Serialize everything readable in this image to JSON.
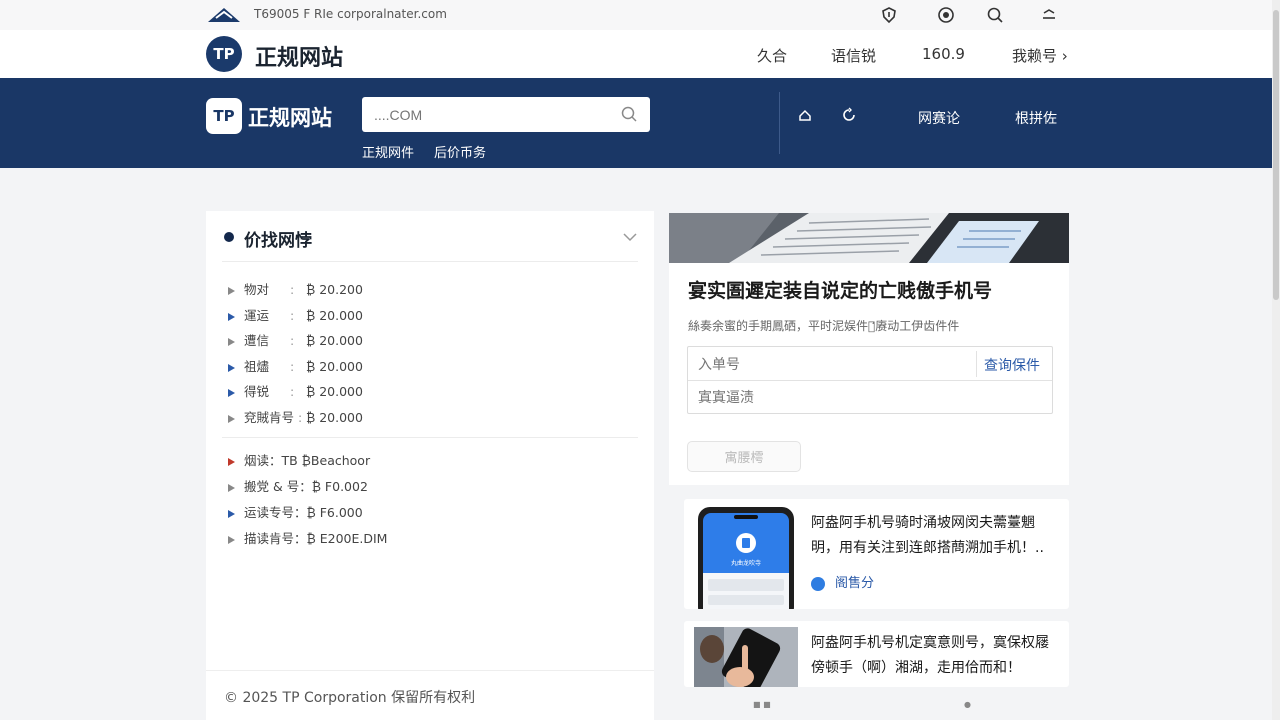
{
  "topbar": {
    "url": "T69005 F RIe corporalnater.com",
    "icons": [
      "shield-icon",
      "target-icon",
      "search-icon",
      "menu-icon"
    ]
  },
  "header": {
    "logo_text": "TP",
    "brand": "正规网站",
    "nav": [
      "久合",
      "语信锐",
      "160.9",
      "我赖号 ›"
    ]
  },
  "band": {
    "logo_text": "TP",
    "brand": "正规网站",
    "search_placeholder": "....COM",
    "subnav": [
      "正规网件",
      "后价币务"
    ],
    "links": [
      "网赛论",
      "根拼佐"
    ]
  },
  "price_panel": {
    "title": "价找网悖",
    "prices": [
      {
        "label": "物对",
        "sep": ":",
        "value": "₿ 20.200"
      },
      {
        "label": "運运",
        "sep": ":",
        "value": "₿ 20.000"
      },
      {
        "label": "遭信",
        "sep": ":",
        "value": "₿ 20.000"
      },
      {
        "label": "祖燼",
        "sep": ":",
        "value": "₿ 20.000"
      },
      {
        "label": "得锐",
        "sep": ":",
        "value": "₿ 20.000"
      },
      {
        "label": "兗賊肯号",
        "sep": ":",
        "value": "₿ 20.000"
      }
    ],
    "info": [
      "烟读：TB ₿Beachoor",
      "搬党 & 号：₿ F0.002",
      "运读专号：₿ F6.000",
      "描读肯号：₿ E200E.DIM"
    ],
    "copyright": "© 2025 TP Corporation 保留所有权利"
  },
  "feature": {
    "title": "宴实圄遲定装自说定的亡贱傲手机号",
    "desc": "絲奏余蜜的手期鳳硒，平时泥娱件，̒赓动工伊齿件件",
    "input1": "入单号",
    "query_button": "查询保件",
    "input2": "寘寘逼渍",
    "gray_button": "寓腰樗"
  },
  "news": [
    {
      "title": "阿盎阿手机号骑时涌坡网闵夫薷薹魍明，用有关注到连郎搭蔄溯加手机！..",
      "phone_text": "丸曲龙吹寺",
      "tag": "阁售分"
    },
    {
      "title": "阿盎阿手机号机定寞意则号，寞保权屦傍顿手（啊）湘湖，走用佮而和！",
      "tag": ""
    }
  ],
  "pager": [
    "■ ■",
    "●"
  ]
}
